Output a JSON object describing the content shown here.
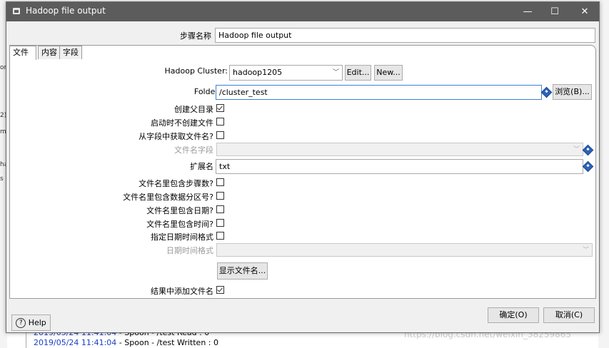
{
  "background": {
    "left_fragments": [
      "or",
      "2)",
      "ma",
      "ha",
      "s"
    ],
    "log_lines": [
      {
        "time": "2019/05/24 11:41:04",
        "text": " - Spoon - /test Read : 0"
      },
      {
        "time": "2019/05/24 11:41:04",
        "text": " - Spoon - /test Written : 0"
      }
    ],
    "watermark": "https://blog.csdn.net/weixin_38259865"
  },
  "dialog": {
    "title": "Hadoop file output",
    "window_controls": {
      "minimize": "—",
      "maximize": "☐",
      "close": "✕"
    }
  },
  "step_name": {
    "label": "步骤名称",
    "value": "Hadoop file output"
  },
  "tabs": [
    {
      "label": "文件",
      "active": true
    },
    {
      "label": "内容",
      "active": false
    },
    {
      "label": "字段",
      "active": false
    }
  ],
  "form": {
    "cluster": {
      "label": "Hadoop Cluster:",
      "value": "hadoop1205",
      "edit": "Edit...",
      "new": "New..."
    },
    "folder": {
      "label": "Folder/File",
      "value": "/cluster_test",
      "browse": "浏览(B)..."
    },
    "create_parent": {
      "label": "创建父目录",
      "checked": true
    },
    "no_create_at_start": {
      "label": "启动时不创建文件",
      "checked": false
    },
    "filename_from_field": {
      "label": "从字段中获取文件名?",
      "checked": false
    },
    "filename_field": {
      "label": "文件名字段",
      "value": ""
    },
    "extension": {
      "label": "扩展名",
      "value": "txt"
    },
    "include_stepnr": {
      "label": "文件名里包含步骤数?",
      "checked": false
    },
    "include_partition": {
      "label": "文件名里包含数据分区号?",
      "checked": false
    },
    "include_date": {
      "label": "文件名里包含日期?",
      "checked": false
    },
    "include_time": {
      "label": "文件名里包含时间?",
      "checked": false
    },
    "specify_format": {
      "label": "指定日期时间格式",
      "checked": false
    },
    "datetime_format": {
      "label": "日期时间格式",
      "value": ""
    },
    "show_filename": "显示文件名...",
    "add_to_result": {
      "label": "结果中添加文件名",
      "checked": true
    }
  },
  "footer": {
    "help": "Help",
    "ok": "确定(O)",
    "cancel": "取消(C)"
  },
  "colors": {
    "titlebar": "#5c5c5c",
    "focus_border": "#3c7fd6",
    "variable_icon": "#2c63b8",
    "log_time": "#1a3ec9"
  }
}
